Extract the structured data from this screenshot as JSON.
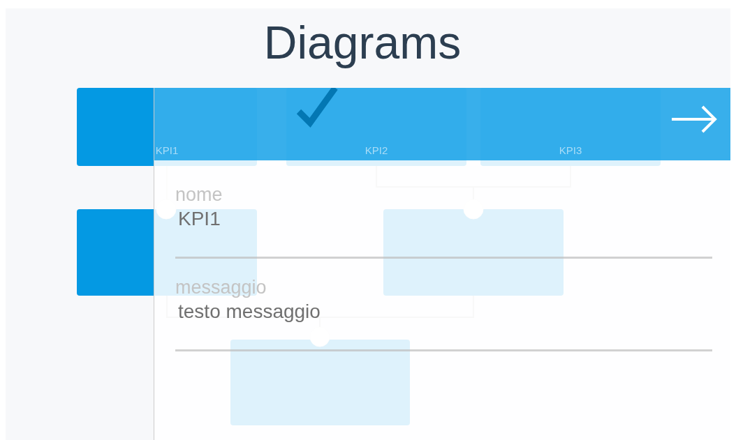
{
  "title": "Diagrams",
  "diagram": {
    "nodes": [
      {
        "label": "KPI1",
        "checked": false
      },
      {
        "label": "KPI2",
        "checked": true
      },
      {
        "label": "KPI3",
        "checked": false
      },
      {
        "checked": false
      },
      {
        "checked": false
      },
      {
        "checked": false
      }
    ]
  },
  "panel": {
    "fields": [
      {
        "label": "nome",
        "value": "KPI1"
      },
      {
        "label": "messaggio",
        "value": "testo messaggio"
      }
    ]
  }
}
